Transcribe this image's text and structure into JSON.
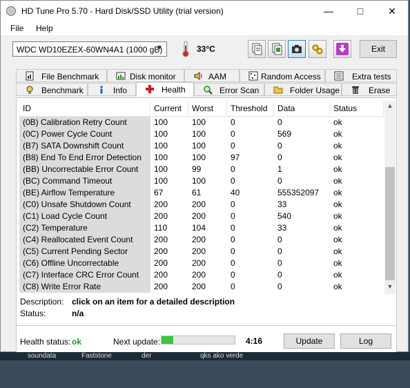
{
  "window": {
    "title": "HD Tune Pro 5.70 - Hard Disk/SSD Utility (trial version)",
    "controls": [
      "minimize",
      "maximize",
      "close"
    ]
  },
  "menu": {
    "file": "File",
    "help": "Help"
  },
  "toolbar": {
    "drive": "WDC WD10EZEX-60WN4A1 (1000 gB)",
    "temperature": "33°C",
    "buttons": [
      "copy-text-icon",
      "copy-image-icon",
      "screenshot-icon",
      "options-icon",
      "save-icon"
    ],
    "exit_label": "Exit"
  },
  "tabs": {
    "row1": [
      "File Benchmark",
      "Disk monitor",
      "AAM",
      "Random Access",
      "Extra tests"
    ],
    "row2": [
      "Benchmark",
      "Info",
      "Health",
      "Error Scan",
      "Folder Usage",
      "Erase"
    ],
    "selected": "Health"
  },
  "table": {
    "headers": [
      "ID",
      "Current",
      "Worst",
      "Threshold",
      "Data",
      "Status"
    ],
    "rows": [
      [
        "(0B) Calibration Retry Count",
        "100",
        "100",
        "0",
        "0",
        "ok"
      ],
      [
        "(0C) Power Cycle Count",
        "100",
        "100",
        "0",
        "569",
        "ok"
      ],
      [
        "(B7) SATA Downshift Count",
        "100",
        "100",
        "0",
        "0",
        "ok"
      ],
      [
        "(B8) End To End Error Detection",
        "100",
        "100",
        "97",
        "0",
        "ok"
      ],
      [
        "(BB) Uncorrectable Error Count",
        "100",
        "99",
        "0",
        "1",
        "ok"
      ],
      [
        "(BC) Command Timeout",
        "100",
        "100",
        "0",
        "0",
        "ok"
      ],
      [
        "(BE) Airflow Temperature",
        "67",
        "61",
        "40",
        "555352097",
        "ok"
      ],
      [
        "(C0) Unsafe Shutdown Count",
        "200",
        "200",
        "0",
        "33",
        "ok"
      ],
      [
        "(C1) Load Cycle Count",
        "200",
        "200",
        "0",
        "540",
        "ok"
      ],
      [
        "(C2) Temperature",
        "110",
        "104",
        "0",
        "33",
        "ok"
      ],
      [
        "(C4) Reallocated Event Count",
        "200",
        "200",
        "0",
        "0",
        "ok"
      ],
      [
        "(C5) Current Pending Sector",
        "200",
        "200",
        "0",
        "0",
        "ok"
      ],
      [
        "(C6) Offline Uncorrectable",
        "200",
        "200",
        "0",
        "0",
        "ok"
      ],
      [
        "(C7) Interface CRC Error Count",
        "200",
        "200",
        "0",
        "0",
        "ok"
      ],
      [
        "(C8) Write Error Rate",
        "200",
        "200",
        "0",
        "0",
        "ok"
      ]
    ]
  },
  "details": {
    "description_label": "Description:",
    "description_value": "click on an item for a detailed description",
    "status_label": "Status:",
    "status_value": "n/a"
  },
  "footer": {
    "health_label": "Health status:",
    "health_value": "ok",
    "next_update_label": "Next update:",
    "next_update_progress": 0.16,
    "countdown": "4:16",
    "update_label": "Update",
    "log_label": "Log"
  },
  "taskbar": [
    "soundata",
    "Faststone",
    "der",
    "qks ako verde"
  ],
  "colors": {
    "health_ok": "#1a9a1a",
    "progress": "#3cc63c",
    "id_column_bg": "#dcdcdc"
  }
}
